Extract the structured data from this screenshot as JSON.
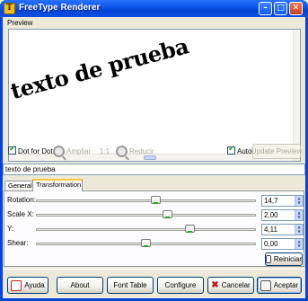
{
  "window": {
    "title": "FreeType Renderer",
    "app_icon": "T"
  },
  "titlebar_buttons": {
    "minimize": "–",
    "maximize": "□",
    "close": "✕"
  },
  "preview": {
    "label": "Preview",
    "sample_text": "texto de prueba"
  },
  "toolbar": {
    "dot_for_dot": {
      "label": "Dot for Dot",
      "checked": true
    },
    "zoom_in": "Ampliar",
    "one_to_one": "1:1",
    "zoom_out": "Reducir",
    "auto": {
      "label": "Auto",
      "checked": true
    },
    "update_preview": "Update Preview"
  },
  "text_input": {
    "value": "texto de prueba"
  },
  "tabs": [
    {
      "label": "General",
      "active": false
    },
    {
      "label": "Transformation",
      "active": true
    }
  ],
  "transformation": {
    "rows": [
      {
        "label": "Rotation:",
        "value": "14,7"
      },
      {
        "label": "Scale X:",
        "value": "2,00"
      },
      {
        "label": "Y:",
        "value": "4,11"
      },
      {
        "label": "Shear:",
        "value": "0,00"
      }
    ],
    "reset_button": "Reiniciar"
  },
  "buttons": {
    "help": "Ayuda",
    "about": "About",
    "font_table": "Font Table",
    "configure": "Configure",
    "cancel": "Cancelar",
    "accept": "Aceptar"
  },
  "colors": {
    "title_bar": "#0a52e4",
    "window_bg": "#ece9d8",
    "button_border": "#003c74"
  }
}
